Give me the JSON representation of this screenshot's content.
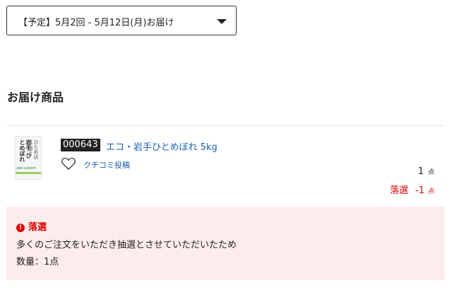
{
  "delivery_select": {
    "selected": "【予定】5月2回 - 5月12日(月)お届け",
    "caret_icon": "caret-down-icon"
  },
  "section": {
    "title": "お届け商品"
  },
  "product": {
    "code": "000643",
    "name": "エコ・岩手ひとめぼれ 5kg",
    "image_label": "岩手 ひとめぼれ",
    "image_sub": "ひとめぼれ 5kg",
    "image_brand": "pal·system",
    "favorite_icon": "heart-outline-icon",
    "review_link": "クチコミ投稿",
    "quantity": "1",
    "quantity_unit": "点",
    "lottery_status": "落選",
    "lottery_delta": "-1",
    "lottery_unit": "点"
  },
  "notice": {
    "icon": "alert-circle-icon",
    "icon_glyph": "!",
    "title": "落選",
    "message": "多くのご注文をいただき抽選とさせていただいたため",
    "quantity_text": "数量：1点"
  },
  "colors": {
    "link": "#1a5fb4",
    "alert": "#e00000",
    "notice_bg": "#fdeced"
  }
}
